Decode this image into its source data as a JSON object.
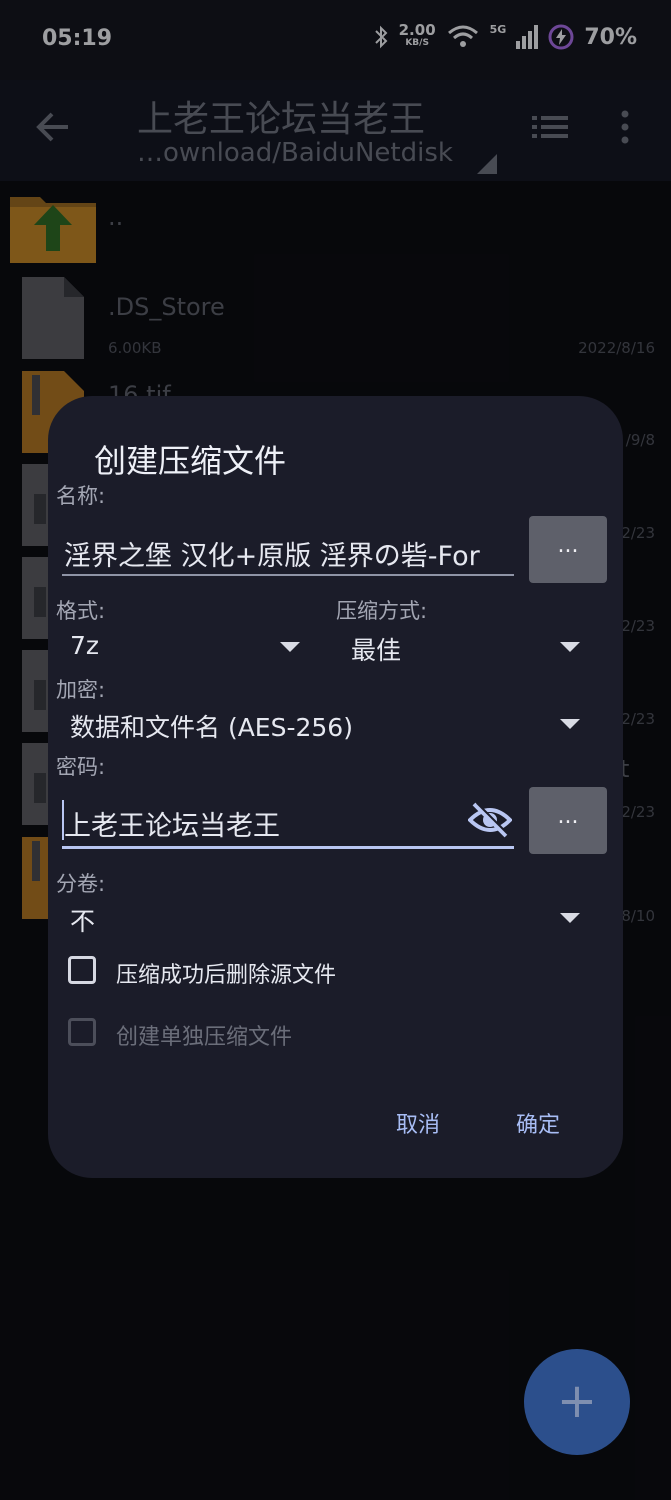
{
  "status": {
    "time": "05:19",
    "speed_value": "2.00",
    "speed_unit": "KB/S",
    "network": "5G",
    "battery": "70%"
  },
  "appbar": {
    "title": "上老王论坛当老王",
    "path": "…ownload/BaiduNetdisk"
  },
  "files": [
    {
      "name": "..",
      "size": "",
      "date": ""
    },
    {
      "name": ".DS_Store",
      "size": "6.00KB",
      "date": "2022/8/16"
    },
    {
      "name": "16.tif",
      "size": "",
      "date": "/9/8"
    },
    {
      "name": "",
      "size": "",
      "date": "2/23"
    },
    {
      "name": "",
      "size": "",
      "date": "2/23"
    },
    {
      "name": "",
      "size": "",
      "date": "2/23"
    },
    {
      "name": "t",
      "size": "",
      "date": "2/23"
    },
    {
      "name": "",
      "size": "",
      "date": "8/10"
    }
  ],
  "dialog": {
    "title": "创建压缩文件",
    "name_label": "名称:",
    "name_value": "淫界之堡 汉化+原版 淫界の砦-For",
    "browse_label": "...",
    "format_label": "格式:",
    "format_value": "7z",
    "method_label": "压缩方式:",
    "method_value": "最佳",
    "encrypt_label": "加密:",
    "encrypt_value": "数据和文件名 (AES-256)",
    "password_label": "密码:",
    "password_value": "上老王论坛当老王",
    "split_label": "分卷:",
    "split_value": "不",
    "delete_source_label": "压缩成功后删除源文件",
    "separate_label": "创建单独压缩文件",
    "cancel": "取消",
    "ok": "确定"
  },
  "fab": {
    "label": "+"
  },
  "colors": {
    "accent": "#a8bdf5",
    "dialog_bg": "#1b1c29",
    "fab": "#2c4f8c",
    "folder": "#c98b2c"
  }
}
